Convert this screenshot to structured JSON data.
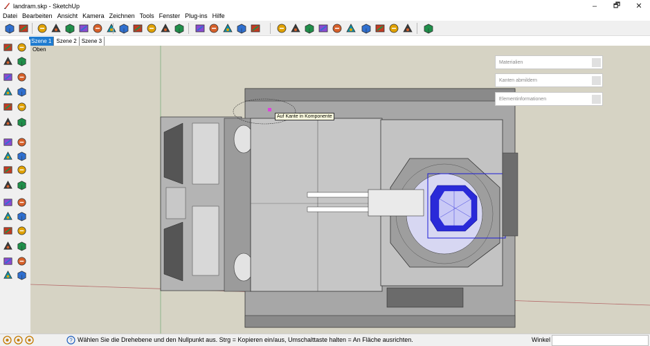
{
  "title": "landram.skp - SketchUp",
  "window": {
    "minimize": "–",
    "restore": "🗗",
    "close": "✕"
  },
  "menu": [
    "Datei",
    "Bearbeiten",
    "Ansicht",
    "Kamera",
    "Zeichnen",
    "Tools",
    "Fenster",
    "Plug-ins",
    "Hilfe"
  ],
  "scenes": [
    "Szene 1",
    "Szene 2",
    "Szene 3"
  ],
  "viewport": {
    "view_name": "Oben",
    "tooltip": "Auf Kante in Komponente"
  },
  "trays": [
    "Materialien",
    "Kanten abmildern",
    "Elementinformationen"
  ],
  "status": {
    "text": "Wählen Sie die Drehebene und den Nullpunkt aus.  Strg = Kopieren ein/aus, Umschalttaste halten = An Fläche ausrichten.",
    "measure_label": "Winkel",
    "measure_value": ""
  },
  "toolbar_icons": [
    "iso-view-icon",
    "box-view-icon",
    "xray-icon",
    "back-edges-icon",
    "wireframe-icon",
    "hidden-line-icon",
    "shaded-icon",
    "textured-icon",
    "sandbox-from-contours-icon",
    "sandbox-from-scratch-icon",
    "sandbox-smoove-icon",
    "sandbox-stamp-icon",
    "sandbox-drape-icon",
    "add-location-icon",
    "toggle-terrain-icon",
    "3d-warehouse-icon",
    "share-model-icon",
    "export-svg-icon",
    "solid-outer-shell-icon",
    "solid-intersect-icon",
    "solid-union-icon",
    "solid-subtract-icon",
    "solid-trim-icon",
    "solid-split-icon",
    "section-plane-icon",
    "section-fill-icon",
    "section-display-icon",
    "section-cuts-icon",
    "extension-icon"
  ],
  "left_tool_icons": [
    "select-icon",
    "make-component-icon",
    "paint-bucket-icon",
    "eraser-icon",
    "rectangle-icon",
    "line-icon",
    "circle-icon",
    "arc-icon",
    "polygon-icon",
    "freehand-icon",
    "move-icon",
    "push-pull-icon",
    "rotate-icon",
    "follow-me-icon",
    "scale-icon",
    "offset-icon",
    "tape-measure-icon",
    "dimension-icon",
    "protractor-icon",
    "text-icon",
    "axes-icon",
    "3d-text-icon",
    "orbit-icon",
    "pan-icon",
    "zoom-icon",
    "zoom-window-icon",
    "zoom-extents-icon",
    "previous-view-icon",
    "position-camera-icon",
    "look-around-icon",
    "walk-icon",
    "section-plane-tool-icon"
  ],
  "status_icons": [
    "geo-location-icon",
    "credits-icon",
    "user-icon",
    "help-icon"
  ],
  "colors": {
    "selection": "#1b1bd6",
    "scene_active": "#1e7bd0",
    "viewport_bg": "#d6d3c4"
  }
}
